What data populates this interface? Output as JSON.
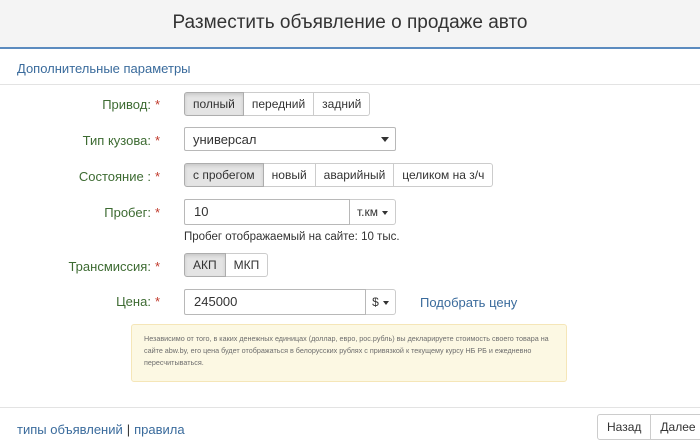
{
  "header": {
    "title": "Разместить объявление о продаже авто"
  },
  "section": {
    "title": "Дополнительные параметры"
  },
  "required_mark": "*",
  "drive": {
    "label": "Привод:",
    "options": [
      "полный",
      "передний",
      "задний"
    ],
    "selected": "полный"
  },
  "body_type": {
    "label": "Тип кузова:",
    "value": "универсал"
  },
  "condition": {
    "label": "Состояние :",
    "options": [
      "с пробегом",
      "новый",
      "аварийный",
      "целиком на з/ч"
    ],
    "selected": "с пробегом"
  },
  "mileage": {
    "label": "Пробег:",
    "value": "10",
    "unit": "т.км",
    "hint": "Пробег отображаемый на сайте: 10 тыс."
  },
  "transmission": {
    "label": "Трансмиссия:",
    "options": [
      "АКП",
      "МКП"
    ],
    "selected": "АКП"
  },
  "price": {
    "label": "Цена:",
    "value": "245000",
    "currency": "$",
    "pick_price_link": "Подобрать цену"
  },
  "notice": {
    "text": "Независимо от того, в каких денежных единицах (доллар, евро, рос.рубль) вы декларируете стоимость своего товара на сайте abw.by, его цена будет отображаться в белорусских рублях с привязкой к текущему курсу НБ РБ и ежедневно пересчитываться."
  },
  "footer": {
    "links": [
      "типы объявлений",
      "правила"
    ],
    "separator": "|",
    "back_button": "Назад",
    "next_button": "Далее"
  },
  "colors": {
    "label_green": "#3d6b32",
    "required_red": "#c0392b",
    "link_blue": "#3a6b9c",
    "notice_bg": "#fcf8e3"
  }
}
